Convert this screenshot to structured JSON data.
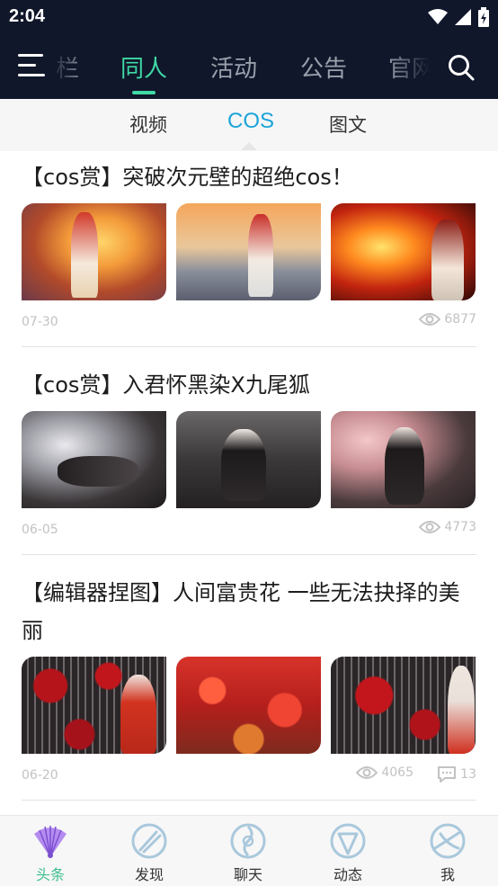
{
  "status_bar": {
    "time": "2:04"
  },
  "top_nav": {
    "tabs": [
      {
        "label": "栏"
      },
      {
        "label": "同人"
      },
      {
        "label": "活动"
      },
      {
        "label": "公告"
      },
      {
        "label": "官网"
      }
    ],
    "active_tab": "同人"
  },
  "sub_tabs": {
    "tabs": [
      {
        "label": "视频"
      },
      {
        "label": "COS"
      },
      {
        "label": "图文"
      }
    ],
    "active_tab": "COS"
  },
  "articles": [
    {
      "title": "【cos赏】突破次元壁的超绝cos！",
      "date": "07-30",
      "views": "6877"
    },
    {
      "title": "【cos赏】入君怀黑染X九尾狐",
      "date": "06-05",
      "views": "4773"
    },
    {
      "title": "【编辑器捏图】人间富贵花 一些无法抉择的美丽",
      "date": "06-20",
      "views": "4065",
      "comments": "13"
    }
  ],
  "bottom_nav": {
    "items": [
      {
        "label": "头条",
        "icon": "fan-icon"
      },
      {
        "label": "发现",
        "icon": "discover-icon"
      },
      {
        "label": "聊天",
        "icon": "chat-icon"
      },
      {
        "label": "动态",
        "icon": "feed-icon"
      },
      {
        "label": "我",
        "icon": "profile-icon"
      }
    ],
    "active_item": "头条"
  },
  "colors": {
    "accent_green": "#3fd9a6",
    "accent_blue": "#1ba4d8",
    "nav_bg": "#10172a"
  }
}
